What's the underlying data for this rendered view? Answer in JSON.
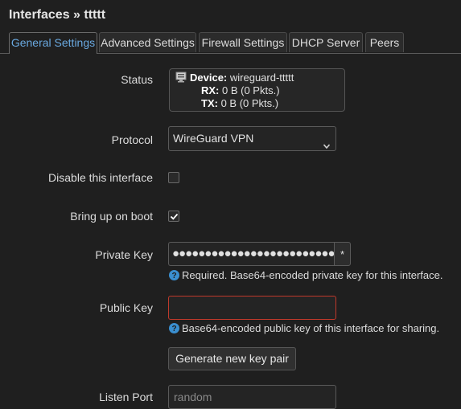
{
  "page": {
    "title": "Interfaces » ttttt"
  },
  "tabs": [
    {
      "label": "General Settings",
      "active": true
    },
    {
      "label": "Advanced Settings",
      "active": false
    },
    {
      "label": "Firewall Settings",
      "active": false
    },
    {
      "label": "DHCP Server",
      "active": false
    },
    {
      "label": "Peers",
      "active": false
    }
  ],
  "status": {
    "label": "Status",
    "device_key": "Device:",
    "device_value": "wireguard-ttttt",
    "rx_key": "RX:",
    "rx_value": "0 B (0 Pkts.)",
    "tx_key": "TX:",
    "tx_value": "0 B (0 Pkts.)",
    "icon": "network-device-icon"
  },
  "protocol": {
    "label": "Protocol",
    "value": "WireGuard VPN"
  },
  "disable_interface": {
    "label": "Disable this interface",
    "checked": false
  },
  "bring_up_on_boot": {
    "label": "Bring up on boot",
    "checked": true
  },
  "private_key": {
    "label": "Private Key",
    "masked_value": "●●●●●●●●●●●●●●●●●●●●●●●●●●●●●●●●●●●●●●●●●●●●",
    "reveal_label": "*",
    "help": "Required. Base64-encoded private key for this interface."
  },
  "public_key": {
    "label": "Public Key",
    "value": "",
    "help": "Base64-encoded public key of this interface for sharing."
  },
  "generate_button": {
    "label": "Generate new key pair"
  },
  "listen_port": {
    "label": "Listen Port",
    "placeholder": "random"
  },
  "colors": {
    "background": "#1f1f1f",
    "accent": "#6aa9e0",
    "help_icon": "#3a8fd0",
    "invalid_border": "#c0392b"
  }
}
